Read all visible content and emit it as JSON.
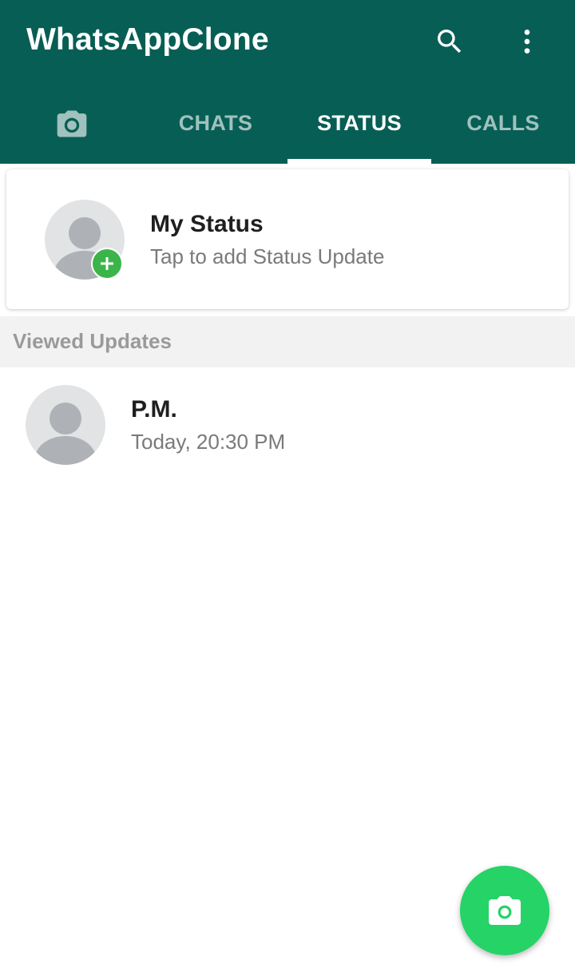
{
  "app": {
    "title": "WhatsAppClone"
  },
  "colors": {
    "header": "#075E54",
    "accent": "#25D366",
    "badge": "#3BB54A"
  },
  "header": {
    "icons": [
      "search-icon",
      "more-vert-icon"
    ]
  },
  "tabs": [
    {
      "label": "",
      "icon": "camera-icon",
      "active": false
    },
    {
      "label": "CHATS",
      "active": false
    },
    {
      "label": "STATUS",
      "active": true
    },
    {
      "label": "CALLS",
      "active": false
    }
  ],
  "my_status": {
    "name": "My Status",
    "subtitle": "Tap to add Status Update",
    "avatar_icon": "person-icon",
    "badge_icon": "plus-icon"
  },
  "viewed_updates": {
    "section_label": "Viewed Updates",
    "items": [
      {
        "name": "P.M.",
        "time": "Today, 20:30 PM",
        "avatar_icon": "person-icon"
      }
    ]
  },
  "fab": {
    "icon": "camera-icon"
  }
}
